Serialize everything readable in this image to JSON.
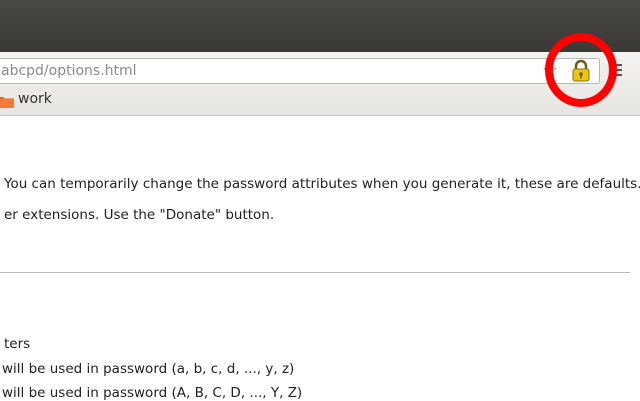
{
  "browser": {
    "url": "abcpd/options.html",
    "star_icon": "star-icon",
    "lock_icon": "lock-icon",
    "menu_icon": "menu-icon"
  },
  "bookmarks": {
    "items": [
      {
        "label": "work",
        "icon": "folder-icon"
      }
    ]
  },
  "annotation": {
    "shape": "circle",
    "color": "#ff0000",
    "target": "lock-icon"
  },
  "content": {
    "line1": "You can temporarily change the password attributes when you generate it, these are defaults.",
    "line2": "er extensions. Use the \"Donate\" button.",
    "line3": "ters",
    "line4": "will be used in password (a, b, c, d, ..., y, z)",
    "line5": "will be used in password (A, B, C, D, ..., Y, Z)"
  }
}
